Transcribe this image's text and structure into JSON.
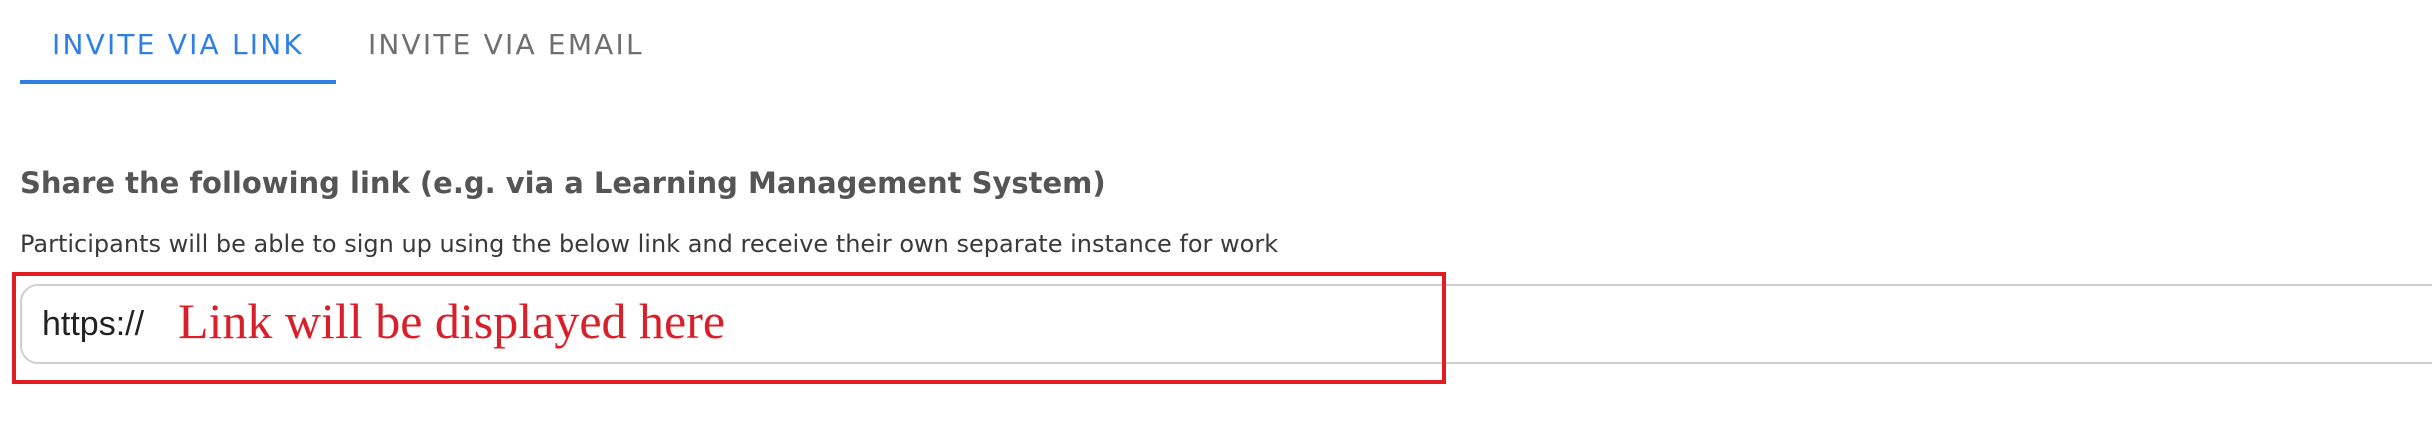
{
  "tabs": [
    {
      "label": "INVITE VIA LINK",
      "active": true
    },
    {
      "label": "INVITE VIA EMAIL",
      "active": false
    }
  ],
  "section": {
    "title": "Share the following link (e.g. via a Learning Management System)",
    "description": "Participants will be able to sign up using the below link and receive their own separate instance for work"
  },
  "link_field": {
    "prefix": "https://",
    "placeholder_text": "Link will be displayed here"
  },
  "colors": {
    "accent_blue": "#2f7fe6",
    "annotation_red": "#e31b23",
    "inactive_tab": "#6f6f6f"
  }
}
